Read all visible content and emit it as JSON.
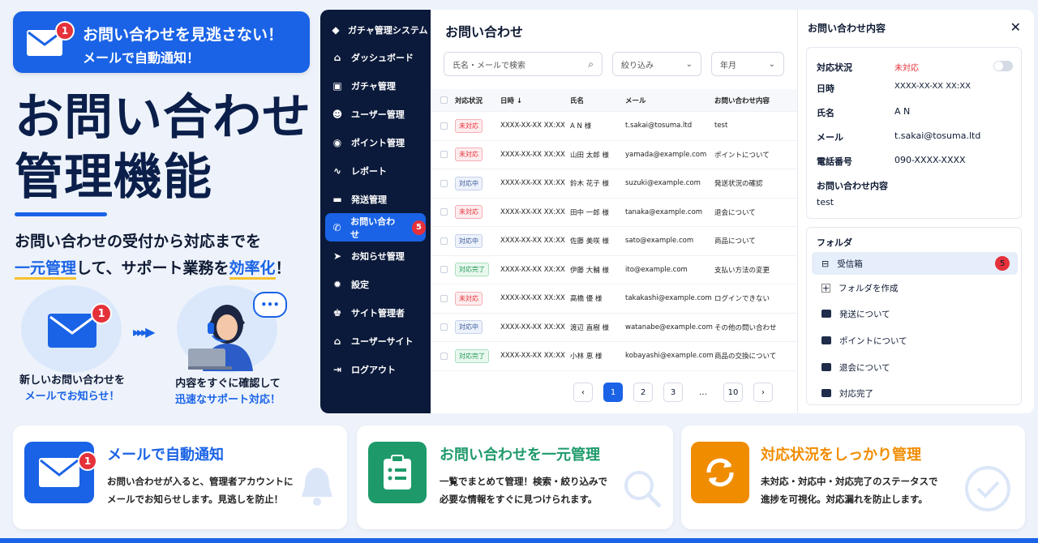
{
  "banner": {
    "line1": "お問い合わせを見逃さない！",
    "line2": "メールで自動通知！",
    "badge": "1"
  },
  "hero": {
    "line1": "お問い合わせ",
    "line2": "管理機能"
  },
  "subtext": {
    "pre": "お問い合わせの受付から対応までを",
    "hl1": "一元管理",
    "mid": "して、サポート業務を",
    "hl2": "効率化",
    "post": "！"
  },
  "flow": {
    "left_badge": "1",
    "left_caption_1": "新しいお問い合わせを",
    "left_caption_2": "メールでお知らせ！",
    "right_caption_1": "内容をすぐに確認して",
    "right_caption_2": "迅速なサポート対応！"
  },
  "sidebar": {
    "title": "ガチャ管理システム",
    "items": [
      {
        "label": "ダッシュボード",
        "icon": "home-icon"
      },
      {
        "label": "ガチャ管理",
        "icon": "gift-icon"
      },
      {
        "label": "ユーザー管理",
        "icon": "users-icon"
      },
      {
        "label": "ポイント管理",
        "icon": "coin-icon"
      },
      {
        "label": "レポート",
        "icon": "chart-icon"
      },
      {
        "label": "発送管理",
        "icon": "truck-icon"
      },
      {
        "label": "お問い合わせ",
        "icon": "phone-icon",
        "badge": "5"
      },
      {
        "label": "お知らせ管理",
        "icon": "send-icon"
      },
      {
        "label": "設定",
        "icon": "gear-icon"
      },
      {
        "label": "サイト管理者",
        "icon": "admin-icon"
      },
      {
        "label": "ユーザーサイト",
        "icon": "house-icon"
      },
      {
        "label": "ログアウト",
        "icon": "logout-icon"
      }
    ]
  },
  "main": {
    "title": "お問い合わせ",
    "search_placeholder": "氏名・メールで検索",
    "filter_label": "絞り込み",
    "year_label": "年月",
    "headers": [
      "対応状況",
      "日時 ↓",
      "氏名",
      "メール",
      "お問い合わせ内容"
    ],
    "rows": [
      {
        "status": "未対応",
        "kind": "red",
        "date": "XXXX-XX-XX XX:XX",
        "name": "A N 様",
        "mail": "t.sakai@tosuma.ltd",
        "content": "test"
      },
      {
        "status": "未対応",
        "kind": "red",
        "date": "XXXX-XX-XX XX:XX",
        "name": "山田 太郎 様",
        "mail": "yamada@example.com",
        "content": "ポイントについて"
      },
      {
        "status": "対応中",
        "kind": "blue",
        "date": "XXXX-XX-XX XX:XX",
        "name": "鈴木 花子 様",
        "mail": "suzuki@example.com",
        "content": "発送状況の確認"
      },
      {
        "status": "未対応",
        "kind": "red",
        "date": "XXXX-XX-XX XX:XX",
        "name": "田中 一郎 様",
        "mail": "tanaka@example.com",
        "content": "退会について"
      },
      {
        "status": "対応中",
        "kind": "blue",
        "date": "XXXX-XX-XX XX:XX",
        "name": "佐藤 美咲 様",
        "mail": "sato@example.com",
        "content": "商品について"
      },
      {
        "status": "対応完了",
        "kind": "green",
        "date": "XXXX-XX-XX XX:XX",
        "name": "伊藤 大輔 様",
        "mail": "ito@example.com",
        "content": "支払い方法の変更"
      },
      {
        "status": "未対応",
        "kind": "red",
        "date": "XXXX-XX-XX XX:XX",
        "name": "高橋 優 様",
        "mail": "takakashi@example.com",
        "content": "ログインできない"
      },
      {
        "status": "対応中",
        "kind": "blue",
        "date": "XXXX-XX-XX XX:XX",
        "name": "渡辺 直樹 様",
        "mail": "watanabe@example.com",
        "content": "その他の問い合わせ"
      },
      {
        "status": "対応完了",
        "kind": "green",
        "date": "XXXX-XX-XX XX:XX",
        "name": "小林 恵 様",
        "mail": "kobayashi@example.com",
        "content": "商品の交換について"
      }
    ],
    "pager": {
      "prev": "‹",
      "pages": [
        "1",
        "2",
        "3",
        "…",
        "10"
      ],
      "next": "›"
    }
  },
  "detail": {
    "title": "お問い合わせ内容",
    "close": "✕",
    "fields": [
      {
        "key": "対応状況",
        "value": "未対応"
      },
      {
        "key": "日時",
        "value": "XXXX-XX-XX XX:XX"
      },
      {
        "key": "氏名",
        "value": "A N"
      },
      {
        "key": "メール",
        "value": "t.sakai@tosuma.ltd"
      },
      {
        "key": "電話番号",
        "value": "090-XXXX-XXXX"
      }
    ],
    "content_label": "お問い合わせ内容",
    "content_value": "test",
    "folder_title": "フォルダ",
    "inbox_label": "受信箱",
    "inbox_badge": "5",
    "create_label": "フォルダを作成",
    "folders": [
      "発送について",
      "ポイントについて",
      "退会について",
      "対応完了"
    ]
  },
  "features": [
    {
      "title": "メールで自動通知",
      "desc1": "お問い合わせが入ると、管理者アカウントに",
      "desc2": "メールでお知らせします。見逃しを防止！",
      "badge": "1",
      "color": "#1a63e6"
    },
    {
      "title": "お問い合わせを一元管理",
      "desc1": "一覧でまとめて管理！検索・絞り込みで",
      "desc2": "必要な情報をすぐに見つけられます。",
      "color": "#1e9a6a"
    },
    {
      "title": "対応状況をしっかり管理",
      "desc1": "未対応・対応中・対応完了のステータスで",
      "desc2": "進捗を可視化。対応漏れを防止します。",
      "color": "#f08c00"
    }
  ]
}
